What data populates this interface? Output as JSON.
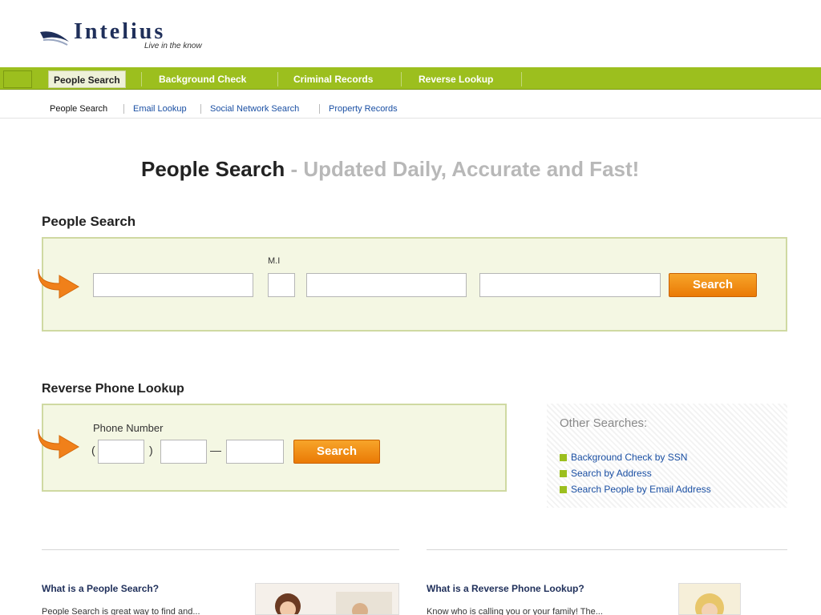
{
  "logo": {
    "name": "Intelius",
    "tagline": "Live in the know"
  },
  "nav": {
    "tabs": [
      {
        "label": "People Search"
      },
      {
        "label": "Background Check"
      },
      {
        "label": "Criminal Records"
      },
      {
        "label": "Reverse Lookup"
      }
    ]
  },
  "subnav": {
    "links": [
      {
        "label": "People Search"
      },
      {
        "label": "Email Lookup"
      },
      {
        "label": "Social Network Search"
      },
      {
        "label": "Property Records"
      }
    ]
  },
  "main": {
    "title_strong": "People Search",
    "title_rest": "- Updated Daily, Accurate and Fast!"
  },
  "people_search": {
    "heading": "People Search",
    "mi_label": "M.I",
    "search_label": "Search"
  },
  "reverse_phone": {
    "heading": "Reverse Phone Lookup",
    "phone_label": "Phone Number",
    "open_paren": "(",
    "close_paren": ")",
    "dash": "—",
    "search_label": "Search"
  },
  "others": {
    "title": "Other Searches:",
    "items": [
      {
        "label": "Background Check by SSN"
      },
      {
        "label": "Search by Address"
      },
      {
        "label": "Search People by Email Address"
      }
    ]
  },
  "bottom": {
    "col1": {
      "heading": "What is a People Search?",
      "text": "People Search is great way to find and..."
    },
    "col2": {
      "heading": "What is a Reverse Phone Lookup?",
      "text": "Know who is calling you or your family! The..."
    }
  },
  "colors": {
    "nav_green": "#9cbf1e",
    "button_orange": "#ea7a05",
    "panel_bg": "#f4f7e3"
  }
}
